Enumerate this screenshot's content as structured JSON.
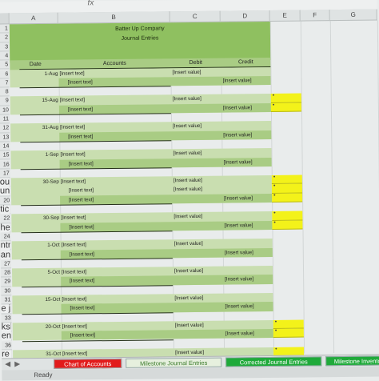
{
  "formula_bar": {
    "fx": "fx"
  },
  "columns": [
    "A",
    "B",
    "C",
    "D",
    "E",
    "F",
    "G"
  ],
  "title": {
    "company": "Batter Up Company",
    "subtitle": "Journal Entries"
  },
  "headers": {
    "date": "Date",
    "accounts": "Accounts",
    "debit": "Debit",
    "credit": "Credit"
  },
  "entries": [
    {
      "date": "1-Aug",
      "lines": [
        "[Insert text]",
        "[Insert text]"
      ],
      "debit": "[Insert value]",
      "credit": "[Insert value]",
      "highlight": false
    },
    {
      "date": "15-Aug",
      "lines": [
        "[Insert text]",
        "[Insert text]"
      ],
      "debit": "[Insert value]",
      "credit": "[Insert value]",
      "highlight": true
    },
    {
      "date": "31-Aug",
      "lines": [
        "[Insert text]",
        "[Insert text]"
      ],
      "debit": "[Insert value]",
      "credit": "[Insert value]",
      "highlight": false
    },
    {
      "date": "1-Sep",
      "lines": [
        "[Insert text]",
        "[Insert text]"
      ],
      "debit": "[Insert value]",
      "credit": "[Insert value]",
      "highlight": false
    },
    {
      "date": "30-Sep",
      "lines": [
        "[Insert text]",
        "[Insert text]",
        "[Insert text]"
      ],
      "debits": [
        "[Insert value]",
        "[Insert value]"
      ],
      "credit": "[Insert value]",
      "highlight": true
    },
    {
      "date": "30-Sep",
      "lines": [
        "[Insert text]",
        "[Insert text]"
      ],
      "debit": "[Insert value]",
      "credit": "[Insert value]",
      "highlight": true
    },
    {
      "date": "1-Oct",
      "lines": [
        "[Insert text]",
        "[Insert text]"
      ],
      "debit": "[Insert value]",
      "credit": "[Insert value]",
      "highlight": false
    },
    {
      "date": "5-Oct",
      "lines": [
        "[Insert text]",
        "[Insert text]"
      ],
      "debit": "[Insert value]",
      "credit": "[Insert value]",
      "highlight": false
    },
    {
      "date": "15-Oct",
      "lines": [
        "[Insert text]",
        "[Insert text]"
      ],
      "debit": "[Insert value]",
      "credit": "[Insert value]",
      "highlight": false
    },
    {
      "date": "20-Oct",
      "lines": [
        "[Insert text]",
        "[Insert text]"
      ],
      "debit": "[Insert value]",
      "credit": "[Insert value]",
      "highlight": true
    },
    {
      "date": "31-Oct",
      "lines": [
        "[Insert text]",
        "[Insert text]"
      ],
      "debit": "[Insert value]",
      "credit": "[Insert value]",
      "highlight": true
    }
  ],
  "left_edge_fragments": [
    "ou",
    "un",
    "tic",
    "he",
    "ntr",
    "an",
    "e jo",
    "ksh",
    "entr",
    "re ar"
  ],
  "sheet_tabs": [
    {
      "label": "Chart of Accounts",
      "color": "#e21b1b",
      "text": "#ffffff"
    },
    {
      "label": "Milestone Journal Entries",
      "color": "#e6f0de",
      "text": "#3a7a2a"
    },
    {
      "label": "Corrected Journal Entries",
      "color": "#1faa3a",
      "text": "#ffffff"
    },
    {
      "label": "Milestone Invento",
      "color": "#1faa3a",
      "text": "#ffffff"
    }
  ],
  "status": "Ready",
  "colors": {
    "title_green": "#8fc060",
    "band_light": "#c9deb0",
    "band_dark": "#a9cc84",
    "highlight_yellow": "#f3f21a"
  }
}
